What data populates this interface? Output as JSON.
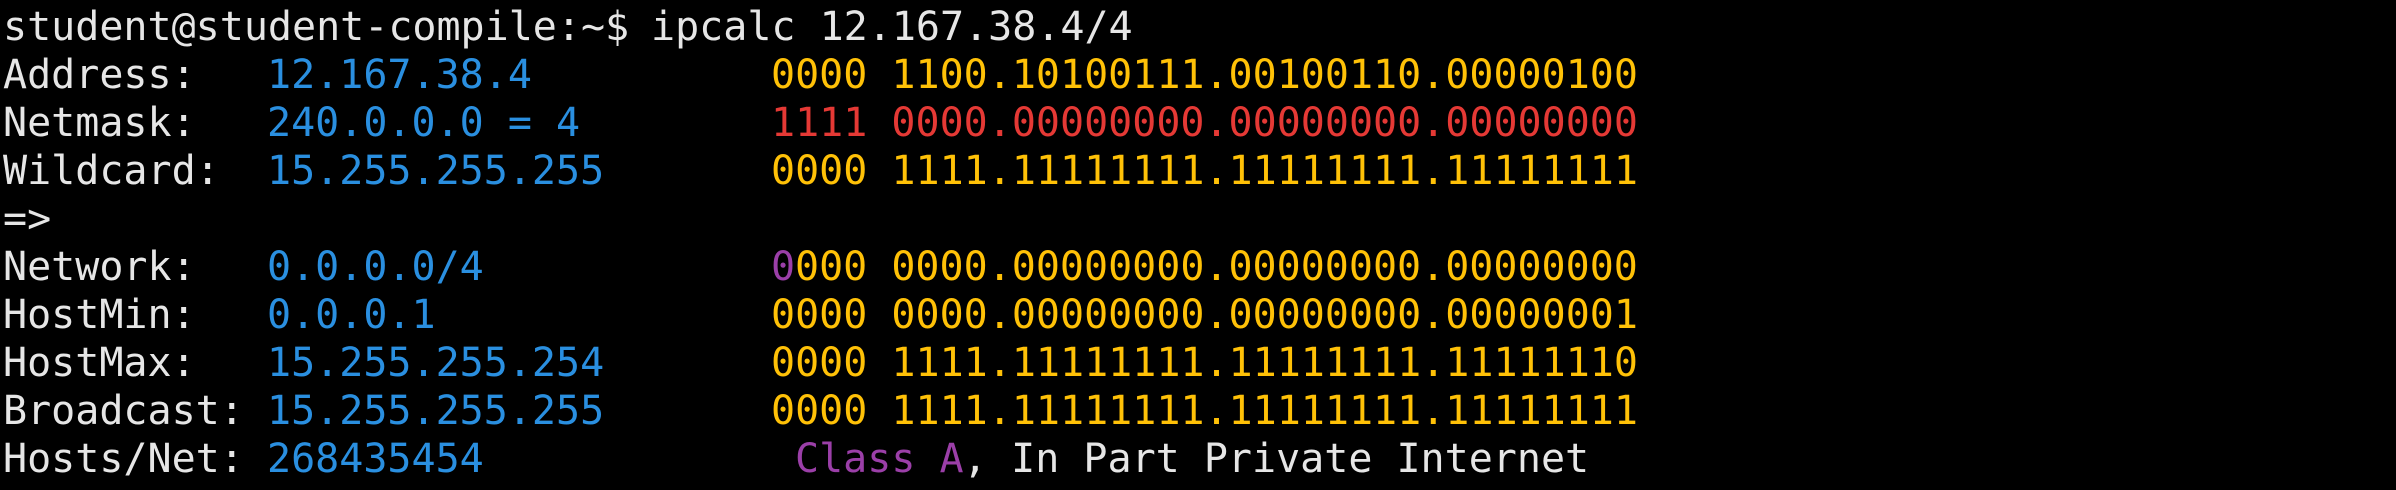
{
  "terminal": {
    "prompt": "student@student-compile:~$ ",
    "command": "ipcalc 12.167.38.4/4",
    "rows": [
      {
        "label": "Address:",
        "value": "12.167.38.4",
        "bin": "0000 1100.10100111.00100110.00000100"
      },
      {
        "label": "Netmask:",
        "value": "240.0.0.0 = 4",
        "bin": "1111 0000.00000000.00000000.00000000"
      },
      {
        "label": "Wildcard:",
        "value": "15.255.255.255",
        "bin": "0000 1111.11111111.11111111.11111111"
      }
    ],
    "arrow": "=>",
    "network": {
      "label": "Network:",
      "value": "0.0.0.0/4",
      "bin_class": "0",
      "bin_rest": "000 0000.00000000.00000000.00000000"
    },
    "rows2": [
      {
        "label": "HostMin:",
        "value": "0.0.0.1",
        "bin": "0000 0000.00000000.00000000.00000001"
      },
      {
        "label": "HostMax:",
        "value": "15.255.255.254",
        "bin": "0000 1111.11111111.11111111.11111110"
      },
      {
        "label": "Broadcast:",
        "value": "15.255.255.255",
        "bin": "0000 1111.11111111.11111111.11111111"
      }
    ],
    "hosts": {
      "label": "Hosts/Net:",
      "value": "268435454",
      "class_label": "Class A",
      "class_note": ", In Part Private Internet"
    }
  },
  "colors": {
    "background": "#000000",
    "text": "#e6e6e6",
    "value": "#2a8fe0",
    "binary": "#ffc107",
    "netmask_binary": "#e53935",
    "class": "#9b3fa8"
  }
}
